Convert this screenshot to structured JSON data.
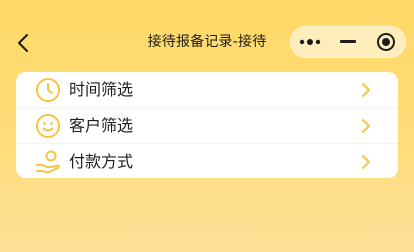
{
  "header": {
    "title": "接待报备记录-接待",
    "back_icon": "chevron-left-icon",
    "more_icon": "more-dots-icon",
    "minimize_icon": "minimize-icon",
    "close_icon": "target-circle-icon"
  },
  "colors": {
    "background_top": "#FFD966",
    "background_bottom": "#FCE098",
    "accent": "#F5C542",
    "card": "#FFFFFF",
    "text": "#1F1F1F"
  },
  "menu": {
    "items": [
      {
        "label": "时间筛选",
        "icon": "clock-icon"
      },
      {
        "label": "客户筛选",
        "icon": "smiley-icon"
      },
      {
        "label": "付款方式",
        "icon": "hand-coin-icon"
      }
    ],
    "arrow_icon": "chevron-right-icon"
  }
}
